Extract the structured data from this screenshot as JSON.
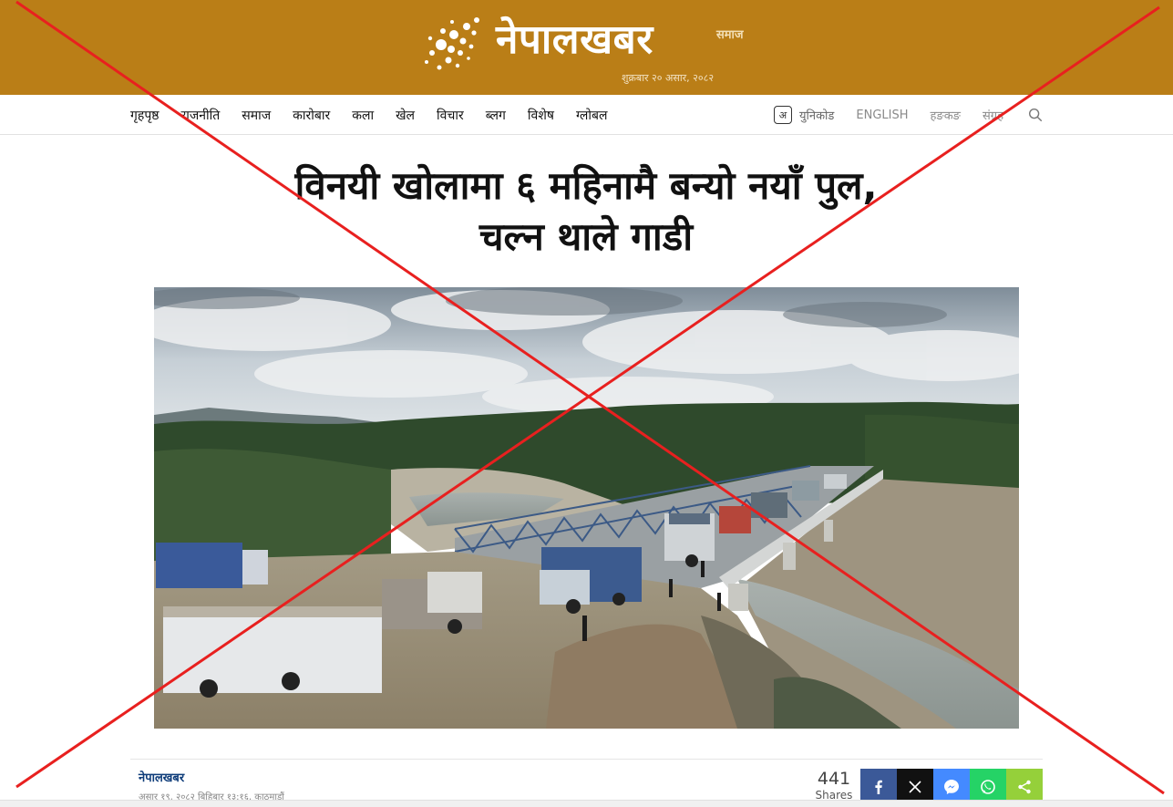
{
  "header": {
    "logo_text": "नेपालखबर",
    "section": "समाज",
    "date": "शुक्रबार २० असार, २०८२"
  },
  "nav": {
    "items": [
      "गृहपृष्ठ",
      "राजनीति",
      "समाज",
      "कारोबार",
      "कला",
      "खेल",
      "विचार",
      "ब्लग",
      "विशेष",
      "ग्लोबल"
    ],
    "unicode_icon": "अ",
    "unicode_label": "युनिकोड",
    "english": "ENGLISH",
    "hongkong": "हङकङ",
    "archive": "संग्रह",
    "search_icon": "search-icon"
  },
  "article": {
    "headline_line1": "विनयी खोलामा ६ महिनामै बन्यो नयाँ पुल,",
    "headline_line2": "चल्न थाले गाडी",
    "author": "नेपालखबर",
    "published": "असार १९, २०८२ बिहिबार १३:१६, काठमाडौं"
  },
  "share": {
    "count": "441",
    "label": "Shares",
    "buttons": [
      "facebook-icon",
      "x-icon",
      "messenger-icon",
      "whatsapp-icon",
      "share-icon"
    ]
  },
  "colors": {
    "masthead": "#ba7e17",
    "cross": "#e8201f",
    "author": "#0f3d7a"
  }
}
